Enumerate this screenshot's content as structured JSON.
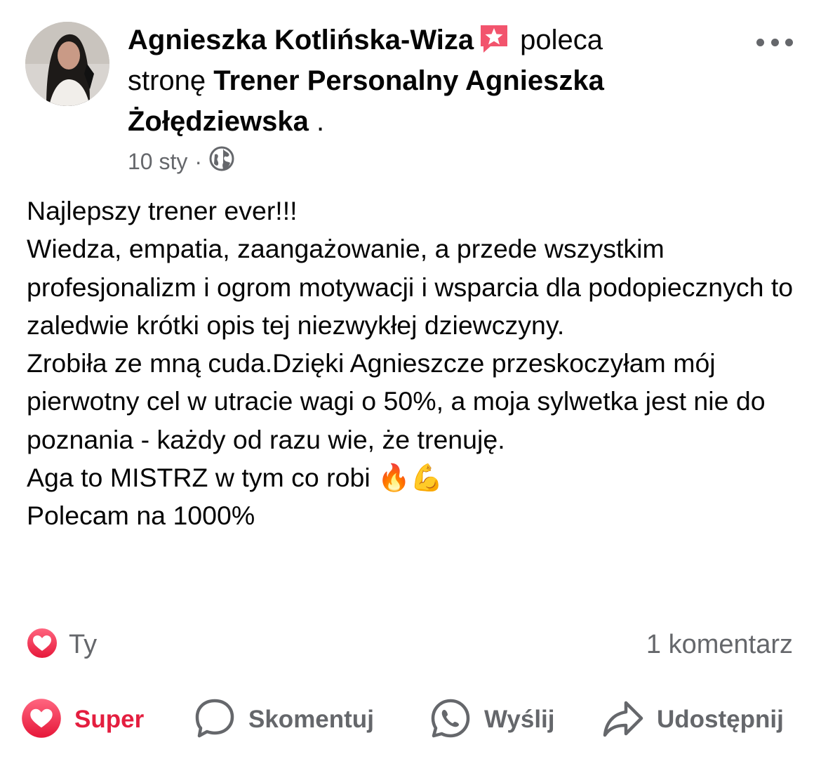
{
  "post": {
    "author": "Agnieszka Kotlińska-Wiza",
    "author_badge_icon": "top-fan-star-badge",
    "verb": "poleca",
    "pre_page": "stronę",
    "page_name": "Trener Personalny Agnieszka Żołędziewska",
    "after_page": " .",
    "timestamp": "10 sty",
    "separator": "·",
    "privacy_icon": "globe-icon",
    "more_icon": "more-options-icon",
    "text": "Najlepszy trener ever!!!\nWiedza, empatia, zaangażowanie, a przede wszystkim profesjonalizm i ogrom motywacji i wsparcia dla podopiecznych to zaledwie krótki opis tej niezwykłej dziewczyny.\nZrobiła ze mną cuda.Dzięki Agnieszcze przeskoczyłam mój pierwotny cel w utracie wagi o 50%, a moja sylwetka jest nie do poznania - każdy od razu wie, że trenuję.\nAga to MISTRZ w tym co robi 🔥💪\nPolecam na 1000%"
  },
  "reactions": {
    "icon": "heart-reaction-icon",
    "names": "Ty",
    "comments": "1 komentarz"
  },
  "actions": {
    "super": "Super",
    "comment": "Skomentuj",
    "send": "Wyślij",
    "share": "Udostępnij"
  },
  "colors": {
    "accent_reaction": "#e41e3f",
    "secondary_text": "#65676b",
    "primary_text": "#050505"
  }
}
